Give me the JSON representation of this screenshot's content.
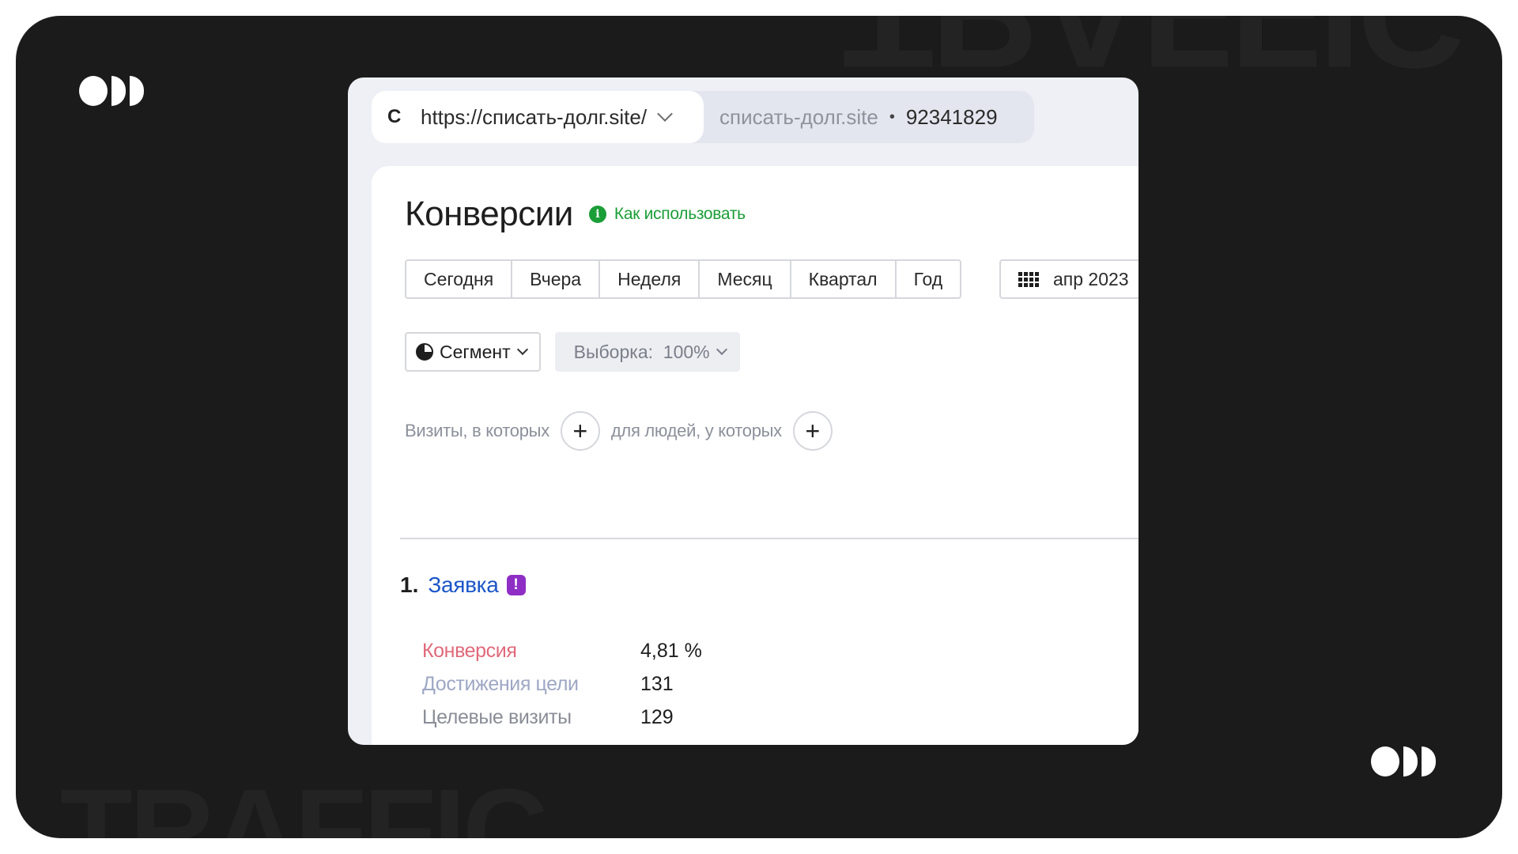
{
  "background": {
    "watermark_top": "TRAFFIC",
    "watermark_bottom": "TRAFFIC"
  },
  "browser": {
    "reload_icon": "C",
    "url": "https://списать-долг.site/",
    "site_name": "списать-долг.site",
    "separator": "•",
    "counter_id": "92341829"
  },
  "page": {
    "title": "Конверсии",
    "help_link": "Как использовать",
    "info_icon_glyph": "i"
  },
  "periods": [
    "Сегодня",
    "Вчера",
    "Неделя",
    "Месяц",
    "Квартал",
    "Год"
  ],
  "date_picker": {
    "label": "апр 2023"
  },
  "segment": {
    "label": "Сегмент"
  },
  "sample": {
    "label": "Выборка:  100%"
  },
  "filters": {
    "visits_label": "Визиты, в которых",
    "people_label": "для людей, у которых",
    "add_glyph": "+"
  },
  "goal": {
    "number": "1.",
    "name": "Заявка",
    "badge_glyph": "!",
    "metrics": [
      {
        "label": "Конверсия",
        "value": "4,81 %",
        "color": "#e0697a"
      },
      {
        "label": "Достижения цели",
        "value": "131",
        "color": "#9ea7c4"
      },
      {
        "label": "Целевые визиты",
        "value": "129",
        "color": "#8a8d96"
      }
    ]
  },
  "colors": {
    "frame_bg": "#1b1b1b",
    "accent_green": "#1a9e37",
    "link_blue": "#1b56c8",
    "badge_purple": "#8e2ec4"
  }
}
